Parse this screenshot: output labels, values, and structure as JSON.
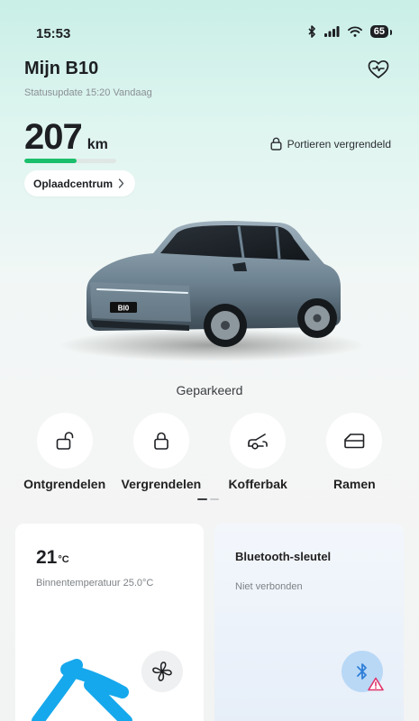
{
  "status_bar": {
    "time": "15:53",
    "battery": "65",
    "icons": [
      "bluetooth-icon",
      "signal-icon",
      "wifi-icon",
      "battery-icon"
    ]
  },
  "header": {
    "title": "Mijn B10",
    "status_update": "Statusupdate 15:20 Vandaag",
    "health_icon": "heart-pulse-icon"
  },
  "range": {
    "value": "207",
    "unit": "km",
    "fill_fraction": 0.57,
    "fill_color": "#1bbf6c"
  },
  "doors": {
    "label": "Portieren vergrendeld",
    "icon": "lock-icon"
  },
  "charging": {
    "label": "Oplaadcentrum",
    "icon": "chevron-right-icon"
  },
  "car": {
    "plate": "BI0",
    "state": "Geparkeerd"
  },
  "actions": [
    {
      "label": "Ontgrendelen",
      "icon": "unlock-icon"
    },
    {
      "label": "Vergrendelen",
      "icon": "lock-icon"
    },
    {
      "label": "Kofferbak",
      "icon": "trunk-icon"
    },
    {
      "label": "Ramen",
      "icon": "window-icon"
    }
  ],
  "climate_card": {
    "temperature": "21",
    "unit": "°C",
    "inside_temp": "Binnentemperatuur 25.0°C",
    "icon": "fan-icon"
  },
  "bluetooth_card": {
    "title": "Bluetooth-sleutel",
    "status": "Niet verbonden",
    "icon": "bluetooth-icon",
    "warning_icon": "warning-icon",
    "accent": "#2f7fd8",
    "warning_color": "#e0356b"
  },
  "annotation_color": "#16a8ec"
}
